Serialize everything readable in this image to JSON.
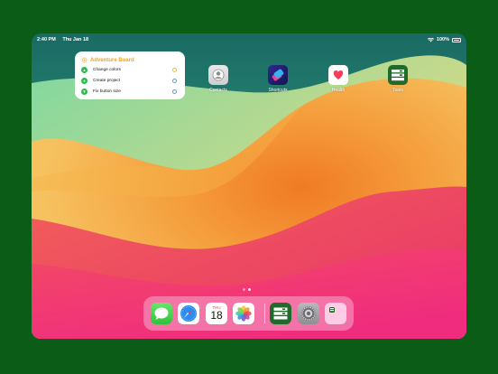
{
  "status_bar": {
    "time": "2:40 PM",
    "date": "Thu Jan 18",
    "battery": "100%"
  },
  "widget": {
    "title": "Adventure Board",
    "items": [
      {
        "label": "Change colors",
        "icon": "triangle-up-icon",
        "color": "#2db84b",
        "check_color": "#f2c21b"
      },
      {
        "label": "Create project",
        "icon": "circle-icon",
        "color": "#2db84b",
        "check_color": "#5b9bd5"
      },
      {
        "label": "Fix button size",
        "icon": "triangle-down-icon",
        "color": "#2db84b",
        "check_color": "#5b9bd5"
      }
    ]
  },
  "home_apps": [
    {
      "label": "Contacts",
      "icon": "contacts-icon"
    },
    {
      "label": "Shortcuts",
      "icon": "shortcuts-icon"
    },
    {
      "label": "Health",
      "icon": "health-icon"
    },
    {
      "label": "Tools",
      "icon": "tools-icon"
    }
  ],
  "page_indicator": {
    "pages": 2,
    "current": 2
  },
  "dock": {
    "apps": [
      {
        "name": "Messages",
        "icon": "messages-icon"
      },
      {
        "name": "Safari",
        "icon": "safari-icon"
      },
      {
        "name": "Calendar",
        "icon": "calendar-icon",
        "day": "THU",
        "date": "18"
      },
      {
        "name": "Photos",
        "icon": "photos-icon"
      },
      {
        "name": "Tools",
        "icon": "tools-icon"
      },
      {
        "name": "Settings",
        "icon": "settings-icon"
      },
      {
        "name": "App Library",
        "icon": "app-library-icon"
      }
    ]
  },
  "colors": {
    "frame": "#0b5c17",
    "accent": "#f2a31b",
    "dock": "#f5aacd"
  }
}
